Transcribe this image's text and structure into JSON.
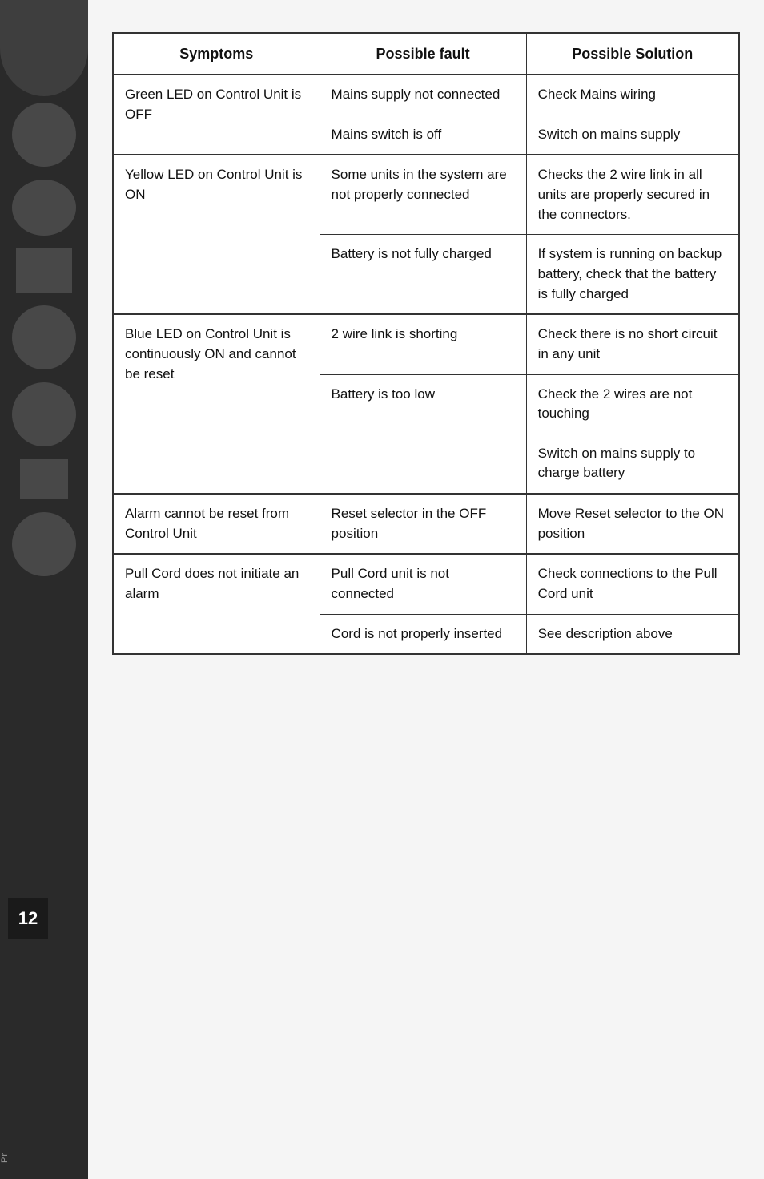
{
  "page": {
    "number": "12"
  },
  "table": {
    "headers": {
      "symptoms": "Symptoms",
      "fault": "Possible fault",
      "solution": "Possible Solution"
    },
    "rows": [
      {
        "id": "row-green-led",
        "symptom": "Green LED on Control Unit is OFF",
        "faults": [
          "Mains supply not connected",
          "Mains switch is off"
        ],
        "solutions": [
          "Check Mains wiring",
          "Switch on mains supply"
        ]
      },
      {
        "id": "row-yellow-led",
        "symptom": "Yellow LED on Control Unit is ON",
        "faults": [
          "Some units in the system are not properly connected",
          "Battery is not fully charged"
        ],
        "solutions": [
          "Checks the 2 wire link in all units are properly secured in the connectors.",
          "If system is running on backup battery, check that the battery is fully charged"
        ]
      },
      {
        "id": "row-blue-led",
        "symptom": "Blue LED on Control Unit is continuously ON and cannot be reset",
        "faults": [
          "2 wire link is shorting",
          "Battery is too low"
        ],
        "solutions": [
          "Check there is no short circuit in any unit",
          "Check the 2 wires are not touching",
          "Switch on mains supply to charge battery"
        ]
      },
      {
        "id": "row-alarm-reset",
        "symptom": "Alarm cannot be reset from Control Unit",
        "faults": [
          "Reset selector in the OFF position"
        ],
        "solutions": [
          "Move Reset selector to the ON position"
        ]
      },
      {
        "id": "row-pull-cord",
        "symptom": "Pull Cord does not initiate an alarm",
        "faults": [
          "Pull Cord unit is not connected",
          "Cord is not properly inserted"
        ],
        "solutions": [
          "Check connections to the Pull Cord unit",
          "See description above"
        ]
      }
    ]
  }
}
